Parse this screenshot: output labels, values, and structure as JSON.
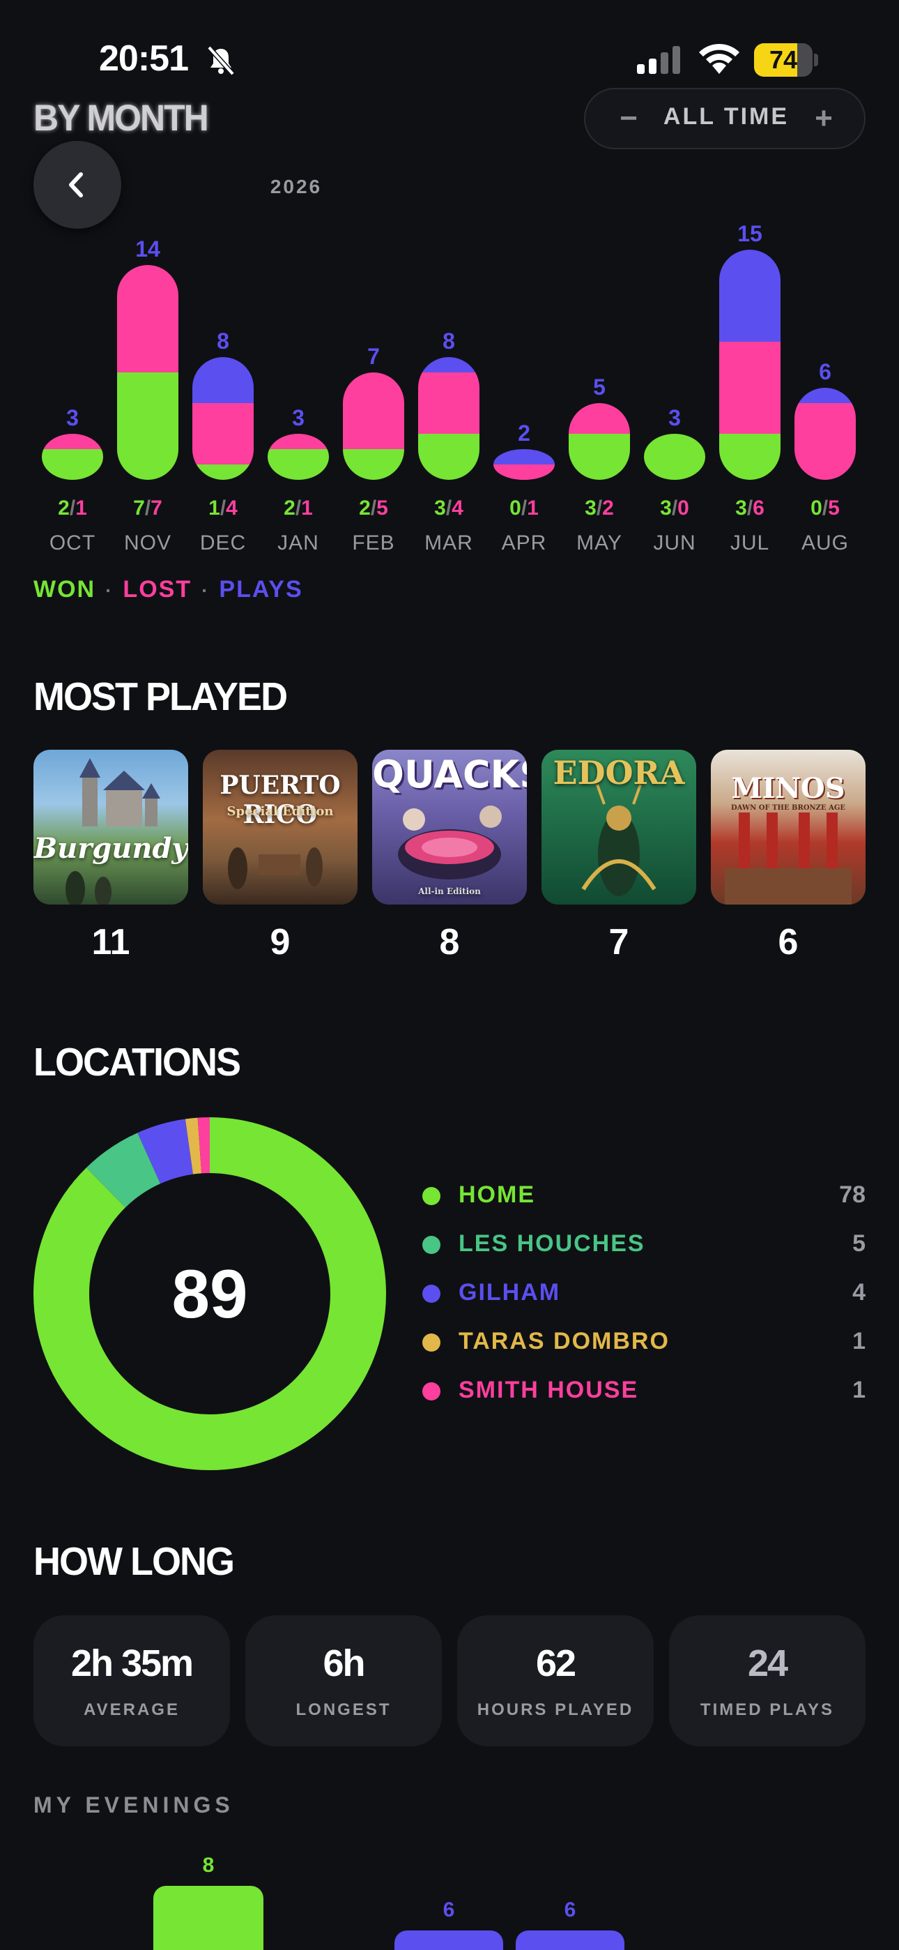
{
  "status_bar": {
    "time": "20:51",
    "battery": 74
  },
  "header": {
    "title": "BY MONTH",
    "range": {
      "minus": "−",
      "label": "ALL TIME",
      "plus": "+"
    },
    "year": "2026"
  },
  "chart_data": {
    "type": "bar",
    "stacked": true,
    "categories": [
      "OCT",
      "NOV",
      "DEC",
      "JAN",
      "FEB",
      "MAR",
      "APR",
      "MAY",
      "JUN",
      "JUL",
      "AUG"
    ],
    "series": [
      {
        "name": "WON",
        "values": [
          2,
          7,
          1,
          2,
          2,
          3,
          0,
          3,
          3,
          3,
          0
        ]
      },
      {
        "name": "LOST",
        "values": [
          1,
          7,
          4,
          1,
          5,
          4,
          1,
          2,
          0,
          6,
          5
        ]
      },
      {
        "name": "PLAYS",
        "values": [
          3,
          14,
          8,
          3,
          7,
          8,
          2,
          5,
          3,
          15,
          6
        ]
      }
    ],
    "ratio_labels": [
      "2/1",
      "7/7",
      "1/4",
      "2/1",
      "2/5",
      "3/4",
      "0/1",
      "3/2",
      "3/0",
      "3/6",
      "0/5"
    ],
    "colors": {
      "won": "#76e534",
      "lost": "#ff3f9e",
      "plays": "#5b4ff0"
    },
    "legend": [
      "WON",
      "LOST",
      "PLAYS"
    ],
    "grid": false
  },
  "most_played": {
    "title": "MOST PLAYED",
    "games": [
      {
        "cover_text": "Burgundy",
        "count": "11"
      },
      {
        "cover_text": "PUERTO RICO",
        "cover_sub": "Special Edition",
        "count": "9"
      },
      {
        "cover_text": "QUACKS",
        "cover_sub": "All-in Edition",
        "count": "8"
      },
      {
        "cover_text": "EDORA",
        "count": "7"
      },
      {
        "cover_text": "MINOS",
        "cover_sub": "DAWN OF THE BRONZE AGE",
        "count": "6"
      }
    ]
  },
  "locations": {
    "title": "LOCATIONS",
    "total": "89",
    "items": [
      {
        "name": "HOME",
        "count": "78",
        "value": 78,
        "color": "#76e534"
      },
      {
        "name": "LES HOUCHES",
        "count": "5",
        "value": 5,
        "color": "#49c585"
      },
      {
        "name": "GILHAM",
        "count": "4",
        "value": 4,
        "color": "#5b4ff0"
      },
      {
        "name": "TARAS DOMBRO",
        "count": "1",
        "value": 1,
        "color": "#e2b84a"
      },
      {
        "name": "SMITH HOUSE",
        "count": "1",
        "value": 1,
        "color": "#ff3f9e"
      }
    ]
  },
  "how_long": {
    "title": "HOW LONG",
    "stats": [
      {
        "value": "2h 35m",
        "label": "AVERAGE"
      },
      {
        "value": "6h",
        "label": "LONGEST"
      },
      {
        "value": "62",
        "label": "HOURS PLAYED"
      },
      {
        "value": "24",
        "label": "TIMED PLAYS"
      }
    ]
  },
  "evenings": {
    "title": "MY EVENINGS",
    "bars": [
      {
        "label": "8",
        "value": 8,
        "color": "#76e534"
      },
      {
        "label": "6",
        "value": 6,
        "color": "#5b4ff0"
      },
      {
        "label": "6",
        "value": 6,
        "color": "#5b4ff0"
      }
    ]
  }
}
